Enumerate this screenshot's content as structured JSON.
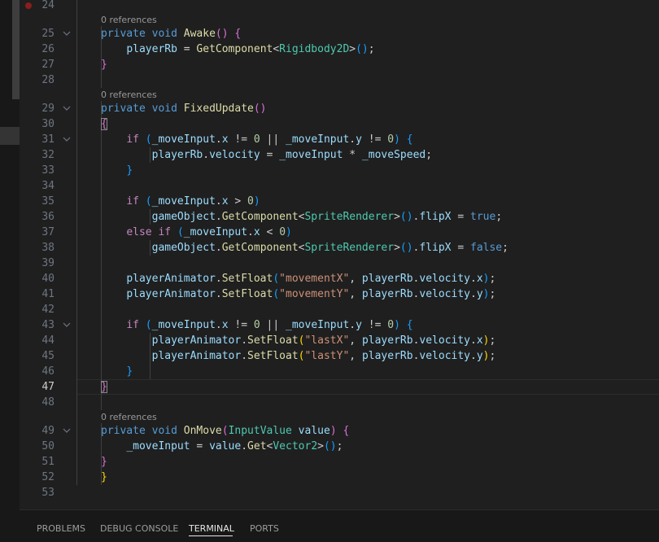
{
  "editor": {
    "line_numbers": [
      "24",
      "25",
      "26",
      "27",
      "28",
      "29",
      "30",
      "31",
      "32",
      "33",
      "34",
      "35",
      "36",
      "37",
      "38",
      "39",
      "40",
      "41",
      "42",
      "43",
      "44",
      "45",
      "46",
      "47",
      "48",
      "49",
      "50",
      "51",
      "52",
      "53"
    ],
    "current_line": "47",
    "codelens": [
      "0 references",
      "0 references",
      "0 references"
    ],
    "lines": [
      [],
      [
        [
          "tk-kw",
          "private"
        ],
        [
          "tk-plain",
          " "
        ],
        [
          "tk-kw",
          "void"
        ],
        [
          "tk-plain",
          " "
        ],
        [
          "tk-fn",
          "Awake"
        ],
        [
          "tk-b2",
          "()"
        ],
        [
          "tk-plain",
          " "
        ],
        [
          "tk-b2",
          "{"
        ]
      ],
      [
        [
          "tk-plain",
          "    "
        ],
        [
          "tk-var",
          "playerRb"
        ],
        [
          "tk-plain",
          " = "
        ],
        [
          "tk-fn",
          "GetComponent"
        ],
        [
          "tk-plain",
          "<"
        ],
        [
          "tk-type",
          "Rigidbody2D"
        ],
        [
          "tk-plain",
          ">"
        ],
        [
          "tk-b3",
          "()"
        ],
        [
          "tk-plain",
          ";"
        ]
      ],
      [
        [
          "tk-b2",
          "}"
        ]
      ],
      [],
      [
        [
          "tk-kw",
          "private"
        ],
        [
          "tk-plain",
          " "
        ],
        [
          "tk-kw",
          "void"
        ],
        [
          "tk-plain",
          " "
        ],
        [
          "tk-fn",
          "FixedUpdate"
        ],
        [
          "tk-b2",
          "()"
        ]
      ],
      [
        [
          "tk-b2 tk-bm",
          "{"
        ]
      ],
      [
        [
          "tk-plain",
          "    "
        ],
        [
          "tk-ctrl",
          "if"
        ],
        [
          "tk-plain",
          " "
        ],
        [
          "tk-b3",
          "("
        ],
        [
          "tk-var",
          "_moveInput"
        ],
        [
          "tk-plain",
          "."
        ],
        [
          "tk-var",
          "x"
        ],
        [
          "tk-plain",
          " != "
        ],
        [
          "tk-num",
          "0"
        ],
        [
          "tk-plain",
          " || "
        ],
        [
          "tk-var",
          "_moveInput"
        ],
        [
          "tk-plain",
          "."
        ],
        [
          "tk-var",
          "y"
        ],
        [
          "tk-plain",
          " != "
        ],
        [
          "tk-num",
          "0"
        ],
        [
          "tk-b3",
          ")"
        ],
        [
          "tk-plain",
          " "
        ],
        [
          "tk-b3",
          "{"
        ]
      ],
      [
        [
          "tk-plain",
          "        "
        ],
        [
          "tk-var",
          "playerRb"
        ],
        [
          "tk-plain",
          "."
        ],
        [
          "tk-var",
          "velocity"
        ],
        [
          "tk-plain",
          " = "
        ],
        [
          "tk-var",
          "_moveInput"
        ],
        [
          "tk-plain",
          " * "
        ],
        [
          "tk-var",
          "_moveSpeed"
        ],
        [
          "tk-plain",
          ";"
        ]
      ],
      [
        [
          "tk-plain",
          "    "
        ],
        [
          "tk-b3",
          "}"
        ]
      ],
      [],
      [
        [
          "tk-plain",
          "    "
        ],
        [
          "tk-ctrl",
          "if"
        ],
        [
          "tk-plain",
          " "
        ],
        [
          "tk-b3",
          "("
        ],
        [
          "tk-var",
          "_moveInput"
        ],
        [
          "tk-plain",
          "."
        ],
        [
          "tk-var",
          "x"
        ],
        [
          "tk-plain",
          " > "
        ],
        [
          "tk-num",
          "0"
        ],
        [
          "tk-b3",
          ")"
        ]
      ],
      [
        [
          "tk-plain",
          "        "
        ],
        [
          "tk-var",
          "gameObject"
        ],
        [
          "tk-plain",
          "."
        ],
        [
          "tk-fn",
          "GetComponent"
        ],
        [
          "tk-plain",
          "<"
        ],
        [
          "tk-type",
          "SpriteRenderer"
        ],
        [
          "tk-plain",
          ">"
        ],
        [
          "tk-b3",
          "()"
        ],
        [
          "tk-plain",
          "."
        ],
        [
          "tk-var",
          "flipX"
        ],
        [
          "tk-plain",
          " = "
        ],
        [
          "tk-kw",
          "true"
        ],
        [
          "tk-plain",
          ";"
        ]
      ],
      [
        [
          "tk-plain",
          "    "
        ],
        [
          "tk-ctrl",
          "else"
        ],
        [
          "tk-plain",
          " "
        ],
        [
          "tk-ctrl",
          "if"
        ],
        [
          "tk-plain",
          " "
        ],
        [
          "tk-b3",
          "("
        ],
        [
          "tk-var",
          "_moveInput"
        ],
        [
          "tk-plain",
          "."
        ],
        [
          "tk-var",
          "x"
        ],
        [
          "tk-plain",
          " < "
        ],
        [
          "tk-num",
          "0"
        ],
        [
          "tk-b3",
          ")"
        ]
      ],
      [
        [
          "tk-plain",
          "        "
        ],
        [
          "tk-var",
          "gameObject"
        ],
        [
          "tk-plain",
          "."
        ],
        [
          "tk-fn",
          "GetComponent"
        ],
        [
          "tk-plain",
          "<"
        ],
        [
          "tk-type",
          "SpriteRenderer"
        ],
        [
          "tk-plain",
          ">"
        ],
        [
          "tk-b3",
          "()"
        ],
        [
          "tk-plain",
          "."
        ],
        [
          "tk-var",
          "flipX"
        ],
        [
          "tk-plain",
          " = "
        ],
        [
          "tk-kw",
          "false"
        ],
        [
          "tk-plain",
          ";"
        ]
      ],
      [],
      [
        [
          "tk-plain",
          "    "
        ],
        [
          "tk-var",
          "playerAnimator"
        ],
        [
          "tk-plain",
          "."
        ],
        [
          "tk-fn",
          "SetFloat"
        ],
        [
          "tk-b3",
          "("
        ],
        [
          "tk-str",
          "\"movementX\""
        ],
        [
          "tk-plain",
          ", "
        ],
        [
          "tk-var",
          "playerRb"
        ],
        [
          "tk-plain",
          "."
        ],
        [
          "tk-var",
          "velocity"
        ],
        [
          "tk-plain",
          "."
        ],
        [
          "tk-var",
          "x"
        ],
        [
          "tk-b3",
          ")"
        ],
        [
          "tk-plain",
          ";"
        ]
      ],
      [
        [
          "tk-plain",
          "    "
        ],
        [
          "tk-var",
          "playerAnimator"
        ],
        [
          "tk-plain",
          "."
        ],
        [
          "tk-fn",
          "SetFloat"
        ],
        [
          "tk-b3",
          "("
        ],
        [
          "tk-str",
          "\"movementY\""
        ],
        [
          "tk-plain",
          ", "
        ],
        [
          "tk-var",
          "playerRb"
        ],
        [
          "tk-plain",
          "."
        ],
        [
          "tk-var",
          "velocity"
        ],
        [
          "tk-plain",
          "."
        ],
        [
          "tk-var",
          "y"
        ],
        [
          "tk-b3",
          ")"
        ],
        [
          "tk-plain",
          ";"
        ]
      ],
      [],
      [
        [
          "tk-plain",
          "    "
        ],
        [
          "tk-ctrl",
          "if"
        ],
        [
          "tk-plain",
          " "
        ],
        [
          "tk-b3",
          "("
        ],
        [
          "tk-var",
          "_moveInput"
        ],
        [
          "tk-plain",
          "."
        ],
        [
          "tk-var",
          "x"
        ],
        [
          "tk-plain",
          " != "
        ],
        [
          "tk-num",
          "0"
        ],
        [
          "tk-plain",
          " || "
        ],
        [
          "tk-var",
          "_moveInput"
        ],
        [
          "tk-plain",
          "."
        ],
        [
          "tk-var",
          "y"
        ],
        [
          "tk-plain",
          " != "
        ],
        [
          "tk-num",
          "0"
        ],
        [
          "tk-b3",
          ")"
        ],
        [
          "tk-plain",
          " "
        ],
        [
          "tk-b3",
          "{"
        ]
      ],
      [
        [
          "tk-plain",
          "        "
        ],
        [
          "tk-var",
          "playerAnimator"
        ],
        [
          "tk-plain",
          "."
        ],
        [
          "tk-fn",
          "SetFloat"
        ],
        [
          "tk-b1",
          "("
        ],
        [
          "tk-str",
          "\"lastX\""
        ],
        [
          "tk-plain",
          ", "
        ],
        [
          "tk-var",
          "playerRb"
        ],
        [
          "tk-plain",
          "."
        ],
        [
          "tk-var",
          "velocity"
        ],
        [
          "tk-plain",
          "."
        ],
        [
          "tk-var",
          "x"
        ],
        [
          "tk-b1",
          ")"
        ],
        [
          "tk-plain",
          ";"
        ]
      ],
      [
        [
          "tk-plain",
          "        "
        ],
        [
          "tk-var",
          "playerAnimator"
        ],
        [
          "tk-plain",
          "."
        ],
        [
          "tk-fn",
          "SetFloat"
        ],
        [
          "tk-b1",
          "("
        ],
        [
          "tk-str",
          "\"lastY\""
        ],
        [
          "tk-plain",
          ", "
        ],
        [
          "tk-var",
          "playerRb"
        ],
        [
          "tk-plain",
          "."
        ],
        [
          "tk-var",
          "velocity"
        ],
        [
          "tk-plain",
          "."
        ],
        [
          "tk-var",
          "y"
        ],
        [
          "tk-b1",
          ")"
        ],
        [
          "tk-plain",
          ";"
        ]
      ],
      [
        [
          "tk-plain",
          "    "
        ],
        [
          "tk-b3",
          "}"
        ]
      ],
      [
        [
          "tk-b2 tk-bm",
          "}"
        ]
      ],
      [],
      [
        [
          "tk-kw",
          "private"
        ],
        [
          "tk-plain",
          " "
        ],
        [
          "tk-kw",
          "void"
        ],
        [
          "tk-plain",
          " "
        ],
        [
          "tk-fn",
          "OnMove"
        ],
        [
          "tk-b2",
          "("
        ],
        [
          "tk-type",
          "InputValue"
        ],
        [
          "tk-plain",
          " "
        ],
        [
          "tk-var",
          "value"
        ],
        [
          "tk-b2",
          ")"
        ],
        [
          "tk-plain",
          " "
        ],
        [
          "tk-b2",
          "{"
        ]
      ],
      [
        [
          "tk-plain",
          "    "
        ],
        [
          "tk-var",
          "_moveInput"
        ],
        [
          "tk-plain",
          " = "
        ],
        [
          "tk-var",
          "value"
        ],
        [
          "tk-plain",
          "."
        ],
        [
          "tk-fn",
          "Get"
        ],
        [
          "tk-plain",
          "<"
        ],
        [
          "tk-type",
          "Vector2"
        ],
        [
          "tk-plain",
          ">"
        ],
        [
          "tk-b3",
          "()"
        ],
        [
          "tk-plain",
          ";"
        ]
      ],
      [
        [
          "tk-b2",
          "}"
        ]
      ],
      [
        [
          "tk-b1",
          "}"
        ]
      ],
      []
    ]
  },
  "panel": {
    "tabs": [
      "PROBLEMS",
      "DEBUG CONSOLE",
      "TERMINAL",
      "PORTS"
    ],
    "active_tab": "TERMINAL"
  },
  "icons": {
    "breakpoint": "breakpoint-dot-icon",
    "fold": "chevron-down-icon"
  }
}
